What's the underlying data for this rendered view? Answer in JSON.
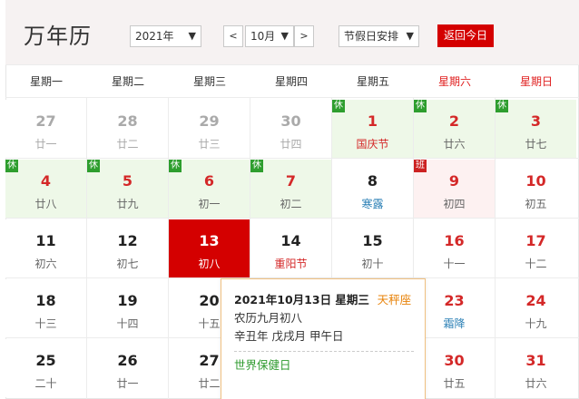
{
  "header": {
    "title": "万年历",
    "year_select": "2021年",
    "month_select": "10月",
    "prev_label": "<",
    "next_label": ">",
    "holiday_select": "节假日安排",
    "today_button": "返回今日",
    "dropdown_icon": "chevron-down-icon"
  },
  "weekdays": [
    "星期一",
    "星期二",
    "星期三",
    "星期四",
    "星期五",
    "星期六",
    "星期日"
  ],
  "rest_tag": "休",
  "work_tag": "班",
  "colors": {
    "accent_red": "#d40000",
    "holiday_bg": "#eef8e8",
    "workday_bg": "#fdf1f1",
    "holiday_tag": "#2e9e2e",
    "solar_term": "#2a7fb5",
    "festival": "#d42828"
  },
  "weeks": [
    [
      {
        "day": "27",
        "lunar": "廿一",
        "other": true
      },
      {
        "day": "28",
        "lunar": "廿二",
        "other": true
      },
      {
        "day": "29",
        "lunar": "廿三",
        "other": true
      },
      {
        "day": "30",
        "lunar": "廿四",
        "other": true
      },
      {
        "day": "1",
        "lunar": "国庆节",
        "tag": "rest",
        "red": true,
        "festival": true
      },
      {
        "day": "2",
        "lunar": "廿六",
        "tag": "rest",
        "red": true
      },
      {
        "day": "3",
        "lunar": "廿七",
        "tag": "rest",
        "red": true
      }
    ],
    [
      {
        "day": "4",
        "lunar": "廿八",
        "tag": "rest",
        "red": true
      },
      {
        "day": "5",
        "lunar": "廿九",
        "tag": "rest",
        "red": true
      },
      {
        "day": "6",
        "lunar": "初一",
        "tag": "rest",
        "red": true
      },
      {
        "day": "7",
        "lunar": "初二",
        "tag": "rest",
        "red": true
      },
      {
        "day": "8",
        "lunar": "寒露",
        "term": true
      },
      {
        "day": "9",
        "lunar": "初四",
        "tag": "work",
        "red": true
      },
      {
        "day": "10",
        "lunar": "初五",
        "red": true
      }
    ],
    [
      {
        "day": "11",
        "lunar": "初六"
      },
      {
        "day": "12",
        "lunar": "初七"
      },
      {
        "day": "13",
        "lunar": "初八",
        "selected": true
      },
      {
        "day": "14",
        "lunar": "重阳节",
        "festival": true
      },
      {
        "day": "15",
        "lunar": "初十"
      },
      {
        "day": "16",
        "lunar": "十一",
        "red": true
      },
      {
        "day": "17",
        "lunar": "十二",
        "red": true
      }
    ],
    [
      {
        "day": "18",
        "lunar": "十三"
      },
      {
        "day": "19",
        "lunar": "十四"
      },
      {
        "day": "20",
        "lunar": "十五"
      },
      {
        "day": "",
        "lunar": ""
      },
      {
        "day": "",
        "lunar": ""
      },
      {
        "day": "23",
        "lunar": "霜降",
        "red": true,
        "term": true
      },
      {
        "day": "24",
        "lunar": "十九",
        "red": true
      }
    ],
    [
      {
        "day": "25",
        "lunar": "二十"
      },
      {
        "day": "26",
        "lunar": "廿一"
      },
      {
        "day": "27",
        "lunar": "廿二"
      },
      {
        "day": "",
        "lunar": ""
      },
      {
        "day": "",
        "lunar": ""
      },
      {
        "day": "30",
        "lunar": "廿五",
        "red": true
      },
      {
        "day": "31",
        "lunar": "廿六",
        "red": true
      }
    ]
  ],
  "popup": {
    "date": "2021年10月13日 星期三",
    "zodiac": "天秤座",
    "lunar": "农历九月初八",
    "ganzhi": "辛丑年 戊戌月 甲午日",
    "festival": "世界保健日"
  }
}
